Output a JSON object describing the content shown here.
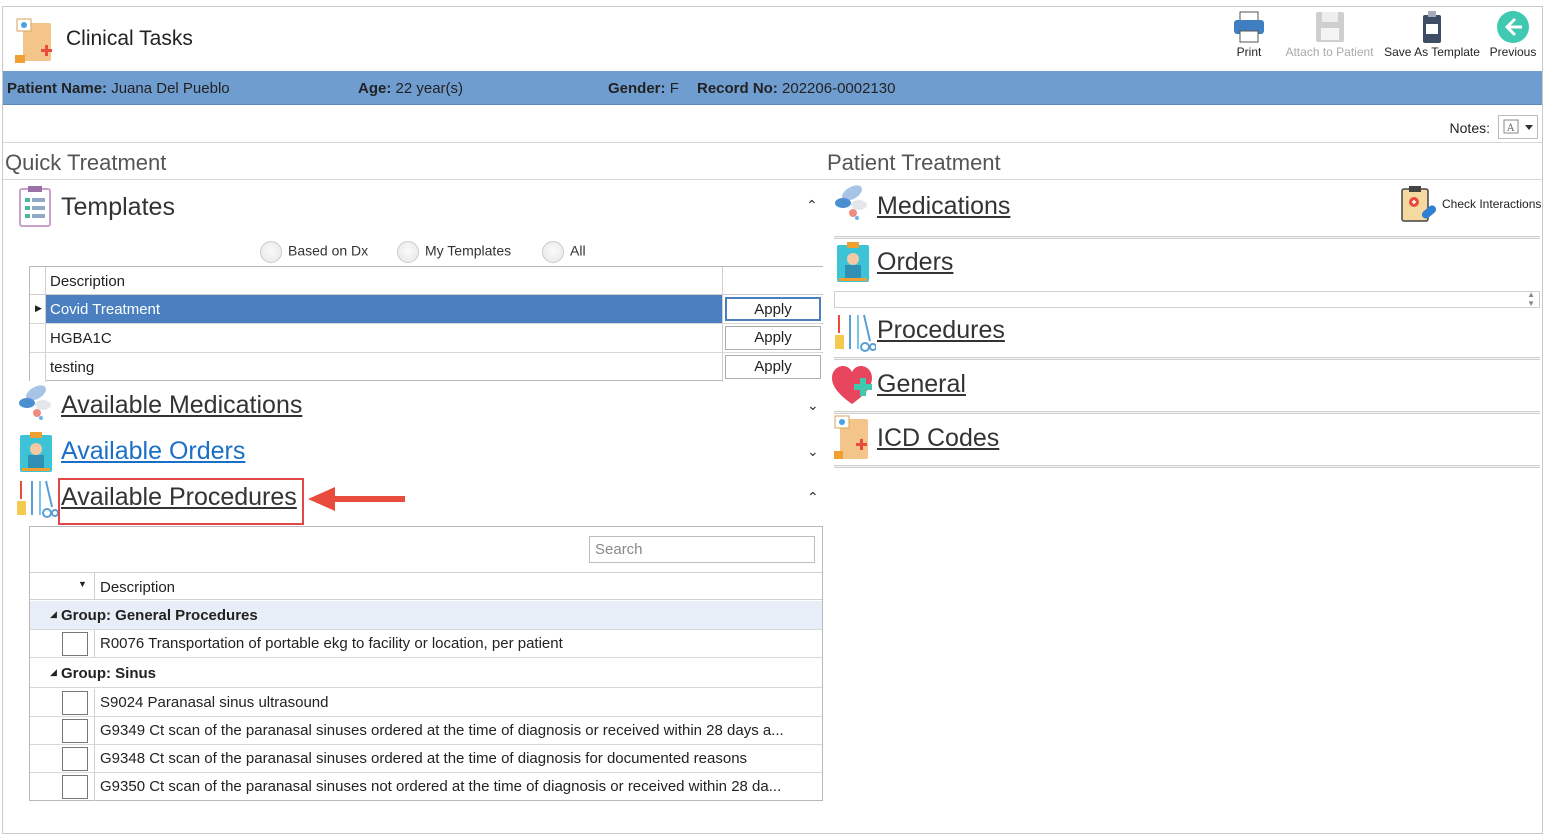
{
  "window": {
    "title": "Clinical Tasks"
  },
  "toolbar": {
    "print": "Print",
    "attach": "Attach to Patient",
    "save_template": "Save As Template",
    "previous": "Previous"
  },
  "patient": {
    "name_label": "Patient Name:",
    "name": "Juana Del Pueblo",
    "age_label": "Age:",
    "age": "22 year(s)",
    "gender_label": "Gender:",
    "gender": "F",
    "record_label": "Record No:",
    "record": "202206-0002130"
  },
  "notes": {
    "label": "Notes:"
  },
  "quick": {
    "heading": "Quick Treatment",
    "templates": {
      "title": "Templates",
      "radios": [
        "Based on Dx",
        "My Templates",
        "All"
      ],
      "column": "Description",
      "rows": [
        {
          "desc": "Covid Treatment",
          "btn": "Apply"
        },
        {
          "desc": "HGBA1C",
          "btn": "Apply"
        },
        {
          "desc": "testing",
          "btn": "Apply"
        }
      ]
    },
    "available_medications": "Available Medications",
    "available_orders": "Available Orders",
    "available_procedures": "Available Procedures",
    "procedures_grid": {
      "search_placeholder": "Search",
      "column": "Description",
      "groups": [
        {
          "title": "Group: General Procedures",
          "rows": [
            "R0076 Transportation of portable ekg to facility or location, per patient"
          ]
        },
        {
          "title": "Group: Sinus",
          "rows": [
            "S9024 Paranasal sinus ultrasound",
            "G9349 Ct scan of the paranasal sinuses ordered at the time of diagnosis or received within 28 days a...",
            "G9348 Ct scan of the paranasal sinuses ordered at the time of diagnosis for documented reasons",
            "G9350 Ct scan of the paranasal sinuses not ordered at the time of diagnosis or received within 28 da..."
          ]
        }
      ]
    }
  },
  "patient_treatment": {
    "heading": "Patient Treatment",
    "medications": "Medications",
    "check_interactions": "Check Interactions",
    "orders": "Orders",
    "procedures": "Procedures",
    "general": "General",
    "icd_codes": "ICD Codes"
  },
  "colors": {
    "band": "#6f9dd0",
    "selection": "#4a7fc0",
    "link": "#1a6fc7",
    "highlight": "#e04848"
  }
}
